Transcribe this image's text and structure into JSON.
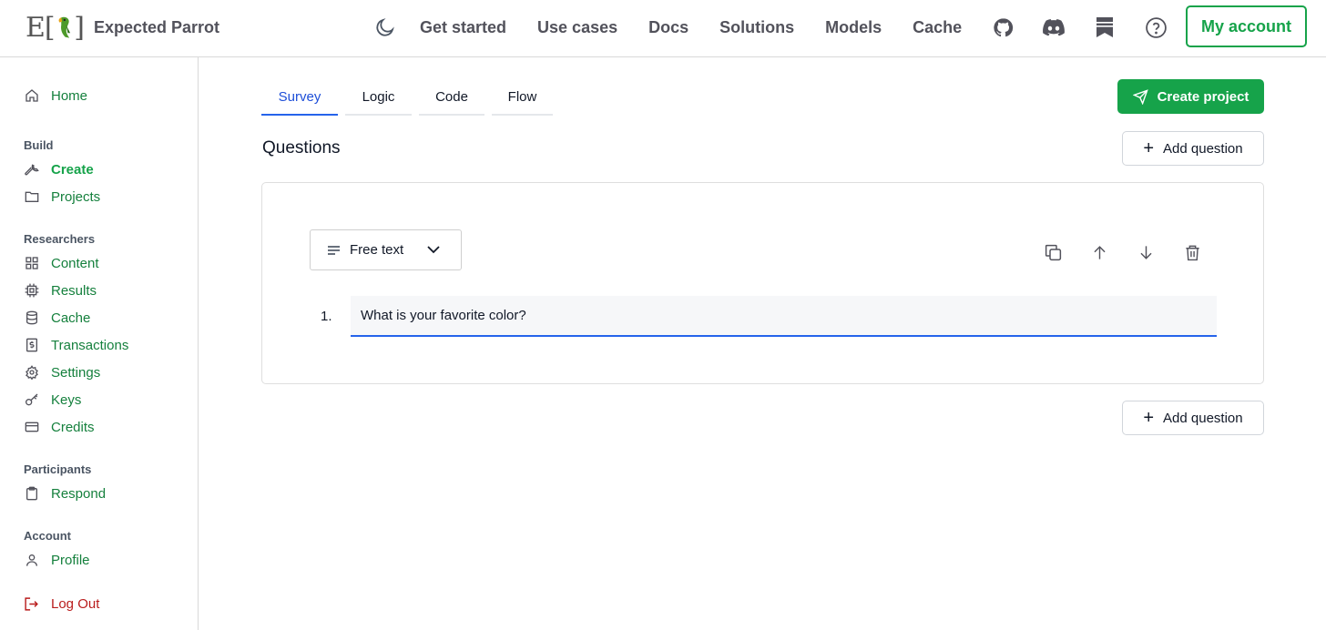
{
  "header": {
    "brand_name": "Expected Parrot",
    "logo_text_left": "E[",
    "logo_text_right": "]",
    "nav": [
      "Get started",
      "Use cases",
      "Docs",
      "Solutions",
      "Models",
      "Cache"
    ],
    "account_label": "My account"
  },
  "sidebar": {
    "home": "Home",
    "build_heading": "Build",
    "create": "Create",
    "projects": "Projects",
    "researchers_heading": "Researchers",
    "content": "Content",
    "results": "Results",
    "cache": "Cache",
    "transactions": "Transactions",
    "settings": "Settings",
    "keys": "Keys",
    "credits": "Credits",
    "participants_heading": "Participants",
    "respond": "Respond",
    "account_heading": "Account",
    "profile": "Profile",
    "logout": "Log Out"
  },
  "main": {
    "tabs": [
      "Survey",
      "Logic",
      "Code",
      "Flow"
    ],
    "active_tab": "Survey",
    "create_project_label": "Create project",
    "questions_title": "Questions",
    "add_question_label": "Add question",
    "question": {
      "type_label": "Free text",
      "number": "1.",
      "text": "What is your favorite color?"
    }
  },
  "colors": {
    "brand_green": "#16a34a",
    "link_green": "#15803d",
    "active_blue": "#2563eb",
    "logout_red": "#b91c1c"
  }
}
